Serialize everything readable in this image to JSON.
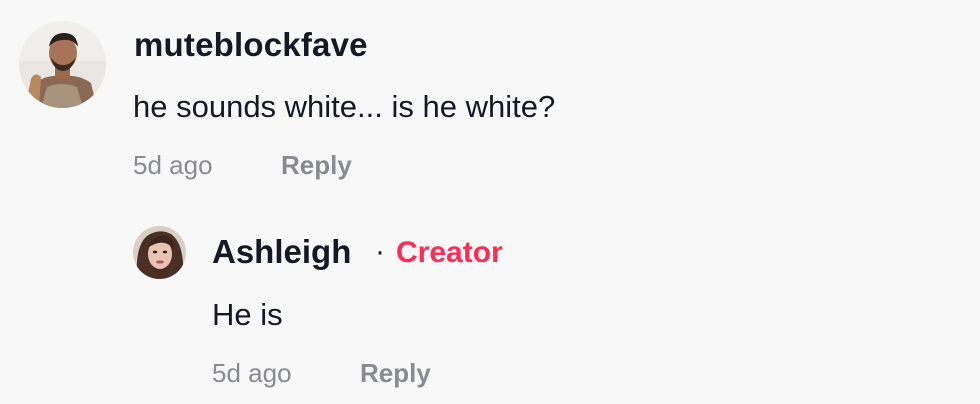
{
  "comment": {
    "username": "muteblockfave",
    "text": "he sounds white... is he white?",
    "timestamp": "5d ago",
    "reply_label": "Reply",
    "avatar_icon": "user-photo-male-avatar"
  },
  "reply": {
    "username": "Ashleigh",
    "separator": "·",
    "badge": "Creator",
    "badge_color": "#fe2c55",
    "text": "He is",
    "timestamp": "5d ago",
    "reply_label": "Reply",
    "avatar_icon": "user-photo-female-avatar"
  }
}
